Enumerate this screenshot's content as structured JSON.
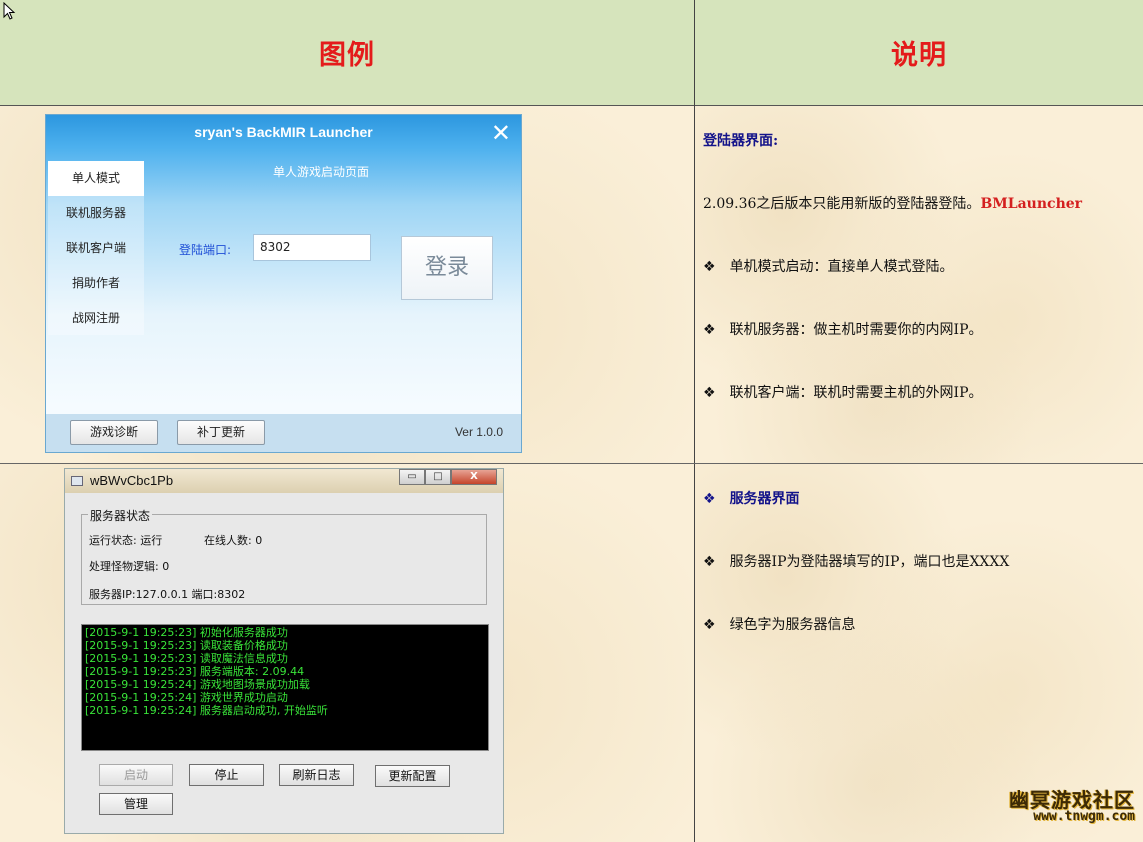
{
  "header": {
    "left": "图例",
    "right": "说明"
  },
  "launcher": {
    "title": "sryan's BackMIR Launcher",
    "close_glyph": "✕",
    "subtitle": "单人游戏启动页面",
    "menu": [
      "单人模式",
      "联机服务器",
      "联机客户端",
      "捐助作者",
      "战网注册"
    ],
    "active_menu": "单人模式",
    "port_label": "登陆端口:",
    "port_value": "8302",
    "login_label": "登录",
    "footer_buttons": [
      "游戏诊断",
      "补丁更新"
    ],
    "version": "Ver 1.0.0"
  },
  "server_window": {
    "title": "wBWvCbc1Pb",
    "window_buttons": [
      "▭",
      "□",
      "X"
    ],
    "group_label": "服务器状态",
    "run_state": "运行状态: 运行",
    "online_count": "在线人数: 0",
    "monster_logic": "处理怪物逻辑: 0",
    "ip_port": "服务器IP:127.0.0.1 端口:8302",
    "log_lines": [
      "[2015-9-1 19:25:23] 初始化服务器成功",
      "[2015-9-1 19:25:23] 读取装备价格成功",
      "[2015-9-1 19:25:23] 读取魔法信息成功",
      "[2015-9-1 19:25:23] 服务端版本: 2.09.44",
      "[2015-9-1 19:25:24] 游戏地图场景成功加载",
      "[2015-9-1 19:25:24] 游戏世界成功启动",
      "[2015-9-1 19:25:24] 服务器启动成功, 开始监听"
    ],
    "buttons": {
      "start": "启动",
      "stop": "停止",
      "refresh_log": "刷新日志",
      "update_config": "更新配置",
      "manage": "管理"
    }
  },
  "desc1": {
    "title": "登陆器界面:",
    "intro": "2.09.36之后版本只能用新版的登陆器登陆。",
    "intro_highlight": "BMLauncher",
    "bullets": [
      "单机模式启动：直接单人模式登陆。",
      "联机服务器：做主机时需要你的内网IP。",
      "联机客户端：联机时需要主机的外网IP。"
    ]
  },
  "desc2": {
    "title": "服务器界面",
    "bullets": [
      "服务器IP为登陆器填写的IP，端口也是XXXX",
      "绿色字为服务器信息"
    ]
  },
  "bullet_glyph": "❖",
  "watermark": {
    "line1": "幽冥游戏社区",
    "line2": "www.tnwgm.com"
  }
}
